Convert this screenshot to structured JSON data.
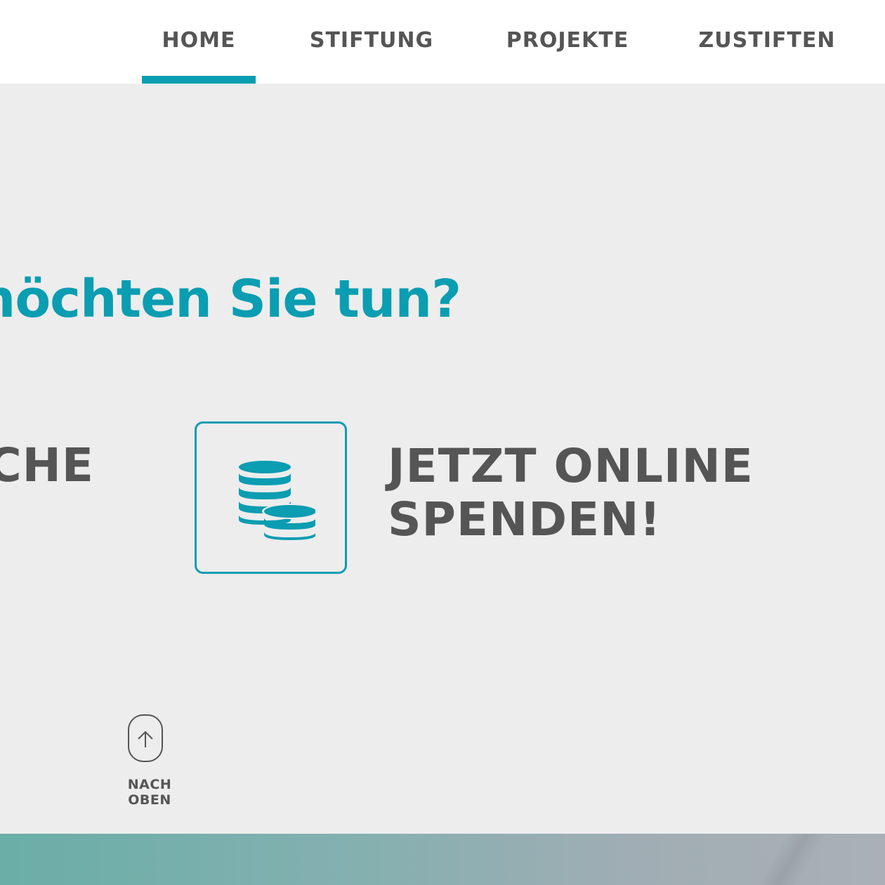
{
  "nav": {
    "items": [
      {
        "label": "HOME",
        "active": true
      },
      {
        "label": "STIFTUNG",
        "active": false
      },
      {
        "label": "PROJEKTE",
        "active": false
      },
      {
        "label": "ZUSTIFTEN",
        "active": false
      }
    ]
  },
  "section": {
    "headline": "nöchten Sie tun?",
    "partial_option_label": "CHE"
  },
  "donate": {
    "icon": "coins-stack-icon",
    "line1": "JETZT ONLINE",
    "line2": "SPENDEN!"
  },
  "to_top": {
    "icon": "arrow-up-icon",
    "label": "NACH OBEN"
  },
  "colors": {
    "accent": "#0b9db1",
    "text_dark": "#555555",
    "nav_background": "#ffffff",
    "page_background": "#ededed"
  }
}
